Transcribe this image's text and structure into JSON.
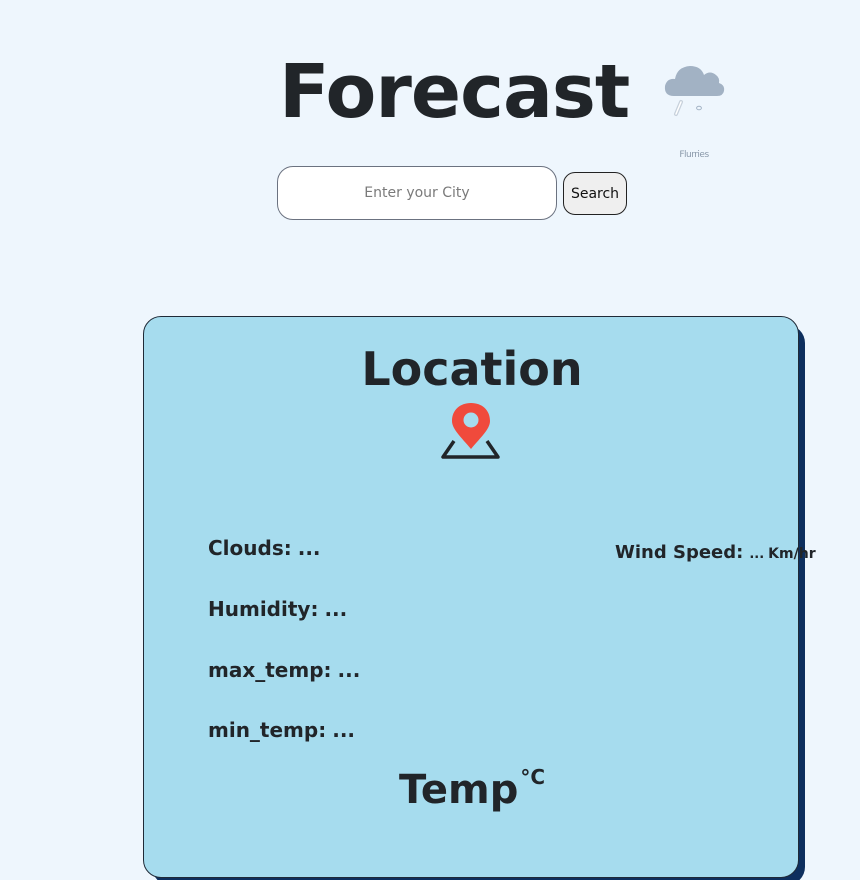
{
  "header": {
    "title": "Forecast"
  },
  "weather_widget": {
    "icon": "cloud-rain-icon",
    "caption": "Flurries"
  },
  "search": {
    "placeholder": "Enter your City",
    "value": "",
    "button_label": "Search"
  },
  "card": {
    "location_title": "Location",
    "location_icon": "map-pin-icon",
    "stats": {
      "clouds_label": "Clouds:",
      "clouds_value": "...",
      "humidity_label": "Humidity:",
      "humidity_value": "...",
      "max_temp_label": "max_temp:",
      "max_temp_value": "...",
      "min_temp_label": "min_temp:",
      "min_temp_value": "..."
    },
    "wind": {
      "label": "Wind Speed:",
      "value": "...",
      "unit": "Km/hr"
    },
    "temp": {
      "label": "Temp",
      "unit": "°C"
    }
  },
  "colors": {
    "background": "#eef6fd",
    "card_background": "#a6dcee",
    "card_shadow": "#0d2f5e",
    "pin_red": "#f04a3c"
  }
}
